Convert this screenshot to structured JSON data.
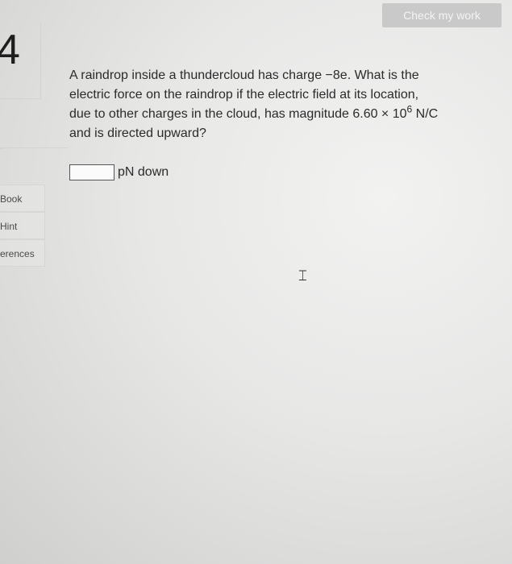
{
  "header": {
    "check_button_label": "Check my work"
  },
  "question": {
    "number": "4",
    "lines": [
      "A raindrop inside a thundercloud has charge −8e. What is the",
      "electric force on the raindrop if the electric field at its location,",
      "due to other charges in the cloud, has magnitude 6.60 × 10",
      "and is directed upward?"
    ],
    "exponent": "6",
    "field_unit": " N/C"
  },
  "answer": {
    "value": "",
    "unit_label": "pN down"
  },
  "sidebar": {
    "items": [
      {
        "label": "Book"
      },
      {
        "label": "Hint"
      },
      {
        "label": "erences"
      }
    ]
  },
  "icons": {
    "cursor": "text-cursor-icon"
  },
  "colors": {
    "button_bg": "#c9c9c9",
    "button_text": "#f4f4f4"
  }
}
